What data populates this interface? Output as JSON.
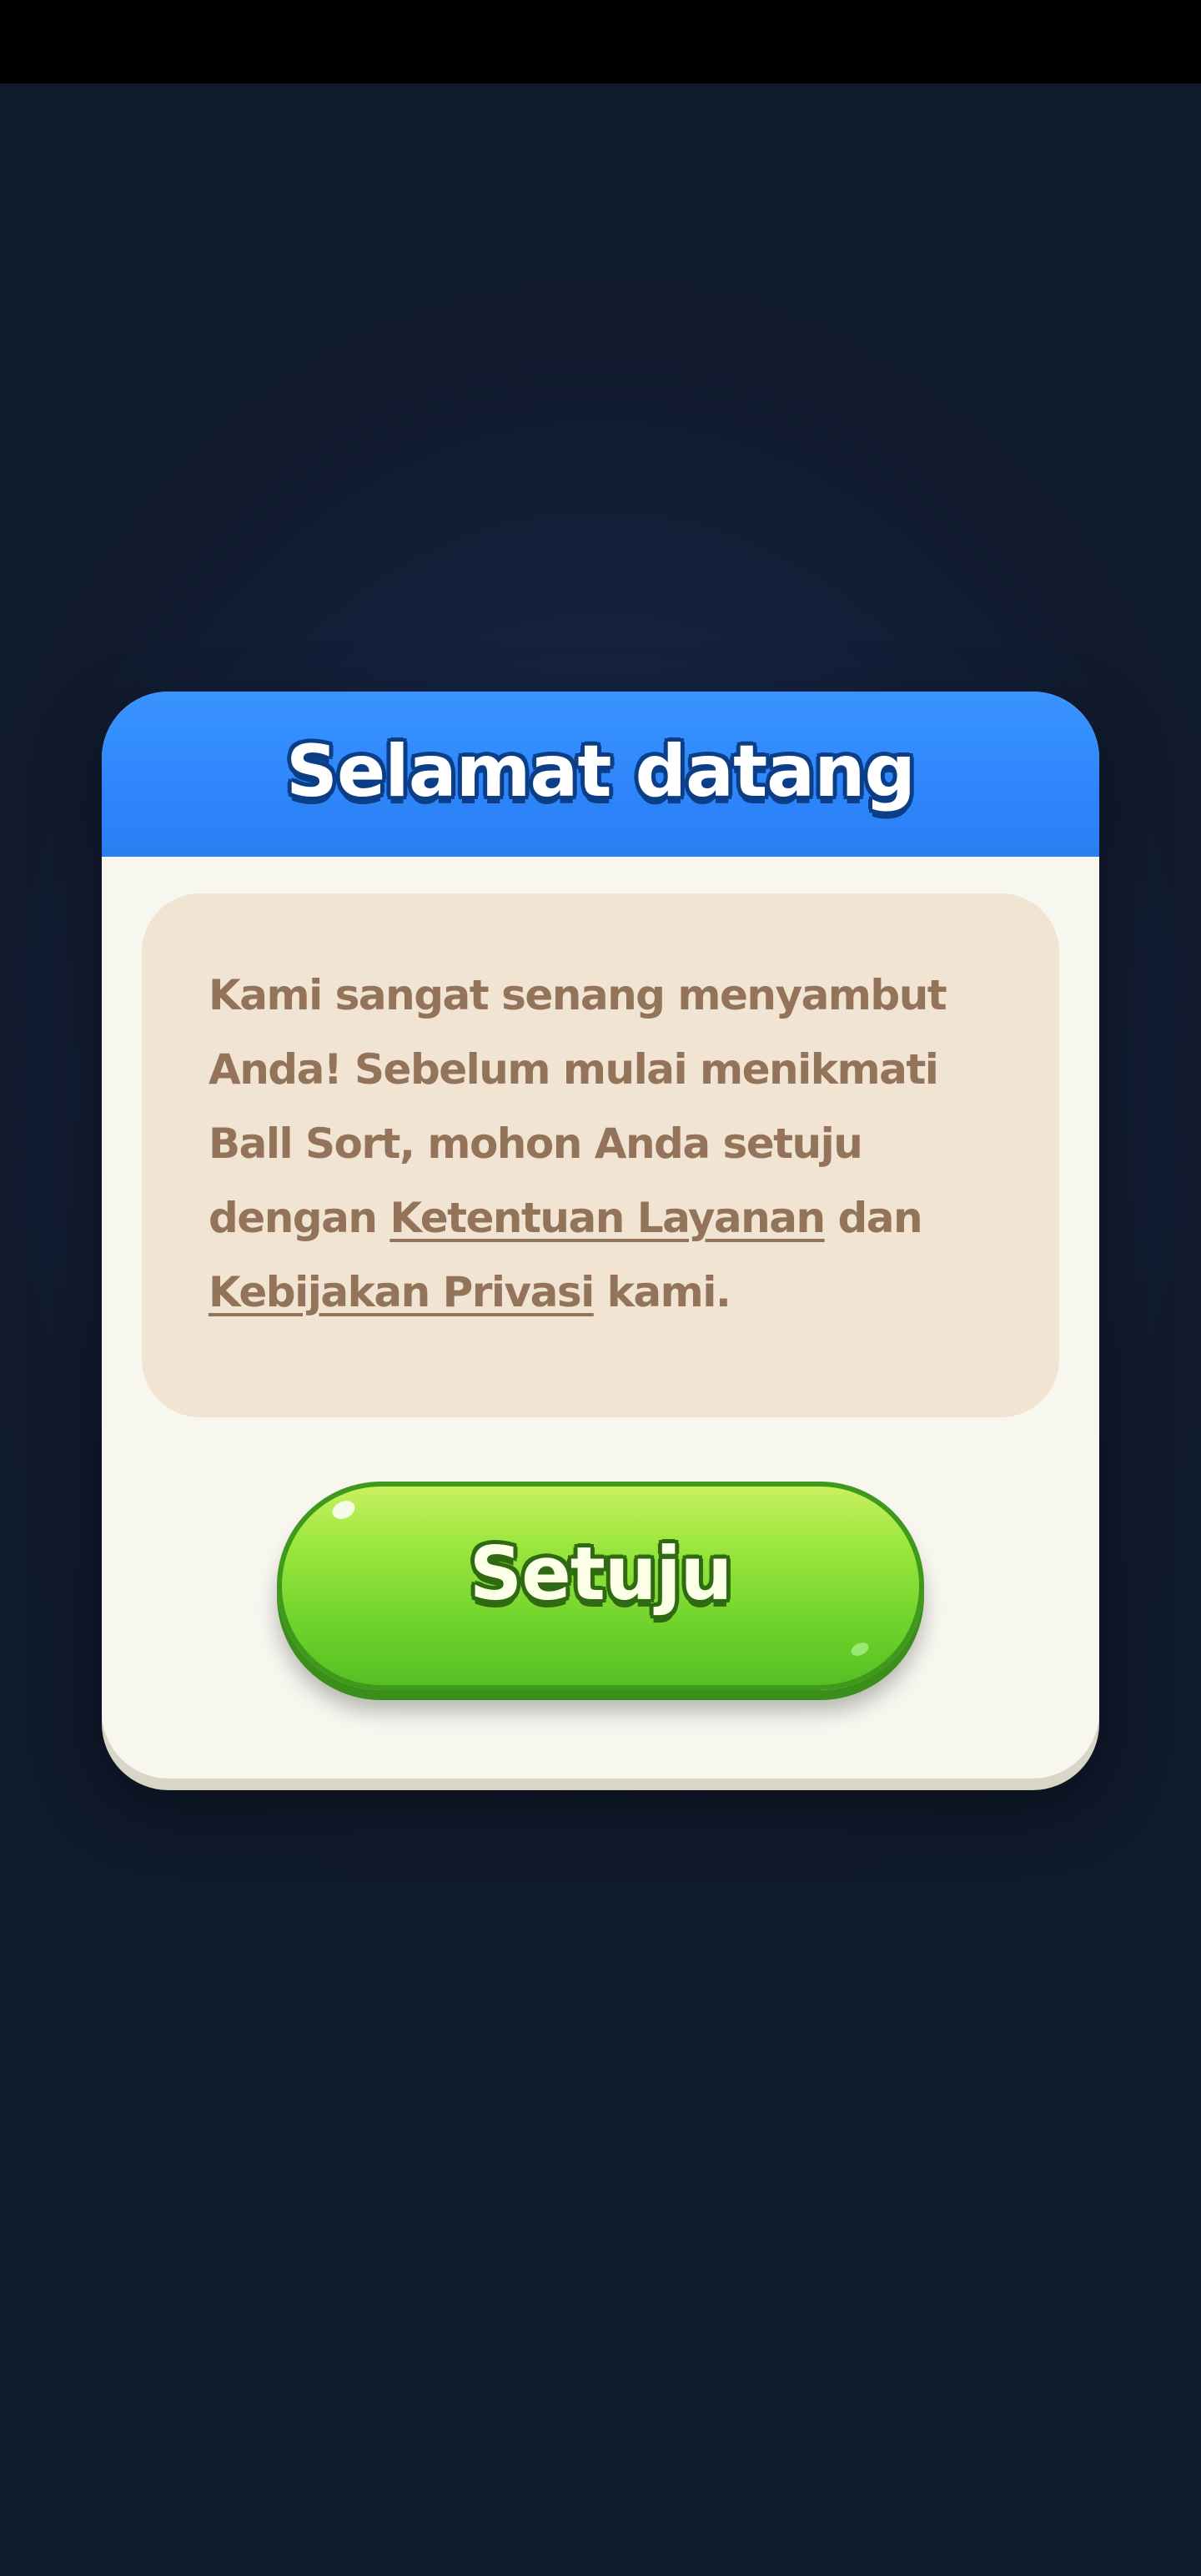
{
  "dialog": {
    "title": "Selamat datang",
    "message": {
      "intro": "Kami sangat senang menyambut Anda! Sebelum mulai menikmati Ball Sort, mohon Anda setuju dengan ",
      "terms_link": "Ketentuan Layanan",
      "conjunction": " dan ",
      "privacy_link": "Kebijakan Privasi",
      "outro": " kami."
    },
    "agree_button_label": "Setuju"
  },
  "colors": {
    "background": "#111a2d",
    "header_blue": "#2e86fb",
    "panel_beige": "#f2e4d3",
    "text_brown": "#93735a",
    "button_green": "#74d62e"
  }
}
